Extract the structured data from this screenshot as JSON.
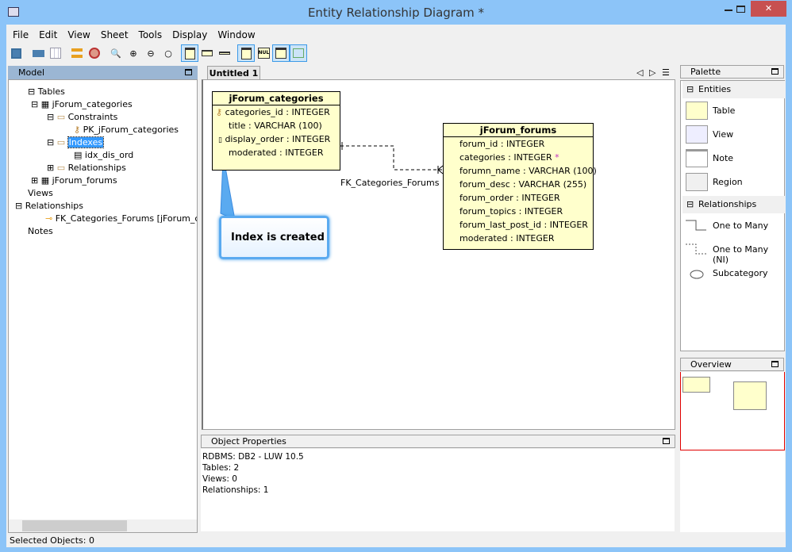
{
  "window": {
    "title": "Entity Relationship Diagram *",
    "min": "minimize",
    "max": "maximize",
    "close": "close"
  },
  "menu": [
    "File",
    "Edit",
    "View",
    "Sheet",
    "Tools",
    "Display",
    "Window"
  ],
  "model": {
    "title": "Model",
    "tree": {
      "tables": "Tables",
      "t1": "jForum_categories",
      "constraints": "Constraints",
      "pk": "PK_jForum_categories",
      "indexes": "Indexes",
      "idx": "idx_dis_ord",
      "rels": "Relationships",
      "t2": "jForum_forums",
      "views": "Views",
      "relationships": "Relationships",
      "fk": "FK_Categories_Forums [jForum_categories]",
      "notes": "Notes"
    }
  },
  "tab": {
    "label": "Untitled 1"
  },
  "diagram": {
    "t1": {
      "name": "jForum_categories",
      "cols": [
        "categories_id : INTEGER",
        "title : VARCHAR (100)",
        "display_order : INTEGER",
        "moderated : INTEGER"
      ]
    },
    "t2": {
      "name": "jForum_forums",
      "cols": [
        "forum_id : INTEGER",
        "categories : INTEGER",
        "forumn_name : VARCHAR (100)",
        "forum_desc : VARCHAR (255)",
        "forum_order : INTEGER",
        "forum_topics : INTEGER",
        "forum_last_post_id : INTEGER",
        "moderated : INTEGER"
      ],
      "fk_marker": "*"
    },
    "rel_label": "FK_Categories_Forums",
    "callout": "Index is created"
  },
  "props": {
    "title": "Object Properties",
    "lines": [
      "RDBMS: DB2 - LUW 10.5",
      "Tables: 2",
      "Views: 0",
      "Relationships: 1"
    ]
  },
  "palette": {
    "title": "Palette",
    "entities": "Entities",
    "items": [
      "Table",
      "View",
      "Note",
      "Region"
    ],
    "relationships": "Relationships",
    "rels": [
      "One to Many",
      "One to Many (NI)",
      "Subcategory"
    ]
  },
  "overview": {
    "title": "Overview"
  },
  "status": "Selected Objects: 0",
  "colors": {
    "entity": "#ffffcc",
    "selection": "#3399ff",
    "callout": "#3c9ae8"
  }
}
